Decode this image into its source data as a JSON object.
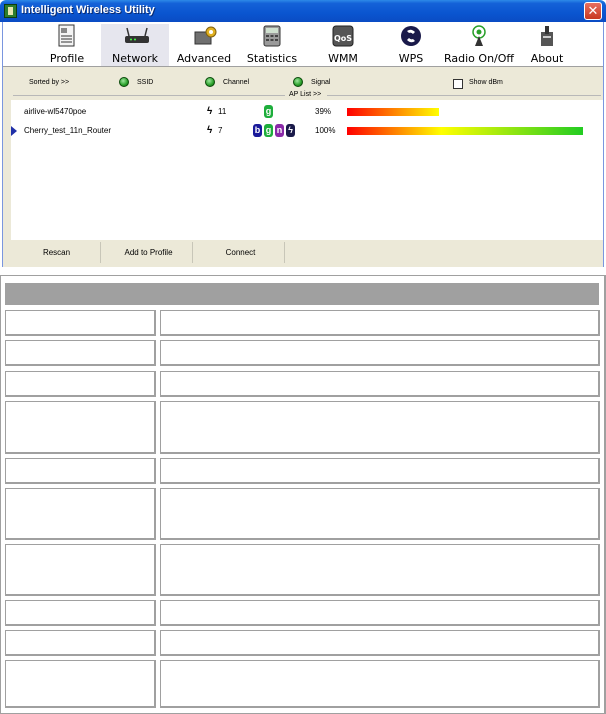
{
  "window": {
    "title": "Intelligent Wireless Utility",
    "close_glyph": "✕"
  },
  "toolbar": {
    "items": [
      {
        "label": "Profile",
        "icon": "profile-icon"
      },
      {
        "label": "Network",
        "icon": "network-icon",
        "active": true
      },
      {
        "label": "Advanced",
        "icon": "advanced-icon"
      },
      {
        "label": "Statistics",
        "icon": "statistics-icon"
      },
      {
        "label": "WMM",
        "icon": "wmm-icon"
      },
      {
        "label": "WPS",
        "icon": "wps-icon"
      },
      {
        "label": "Radio On/Off",
        "icon": "radio-icon"
      },
      {
        "label": "About",
        "icon": "about-icon"
      }
    ]
  },
  "sortbar": {
    "label": "Sorted by >>",
    "options": [
      "SSID",
      "Channel",
      "Signal"
    ],
    "show_dbm_label": "Show dBm",
    "ap_list_label": "AP List >>"
  },
  "ap_list": [
    {
      "ssid": "airlive-wl5470poe",
      "channel": "11",
      "modes": [
        "g"
      ],
      "signal": "39%",
      "signal_value": 0.39,
      "selected": false
    },
    {
      "ssid": "Cherry_test_11n_Router",
      "channel": "7",
      "modes": [
        "b",
        "g",
        "n",
        "wps"
      ],
      "signal": "100%",
      "signal_value": 1.0,
      "selected": true
    }
  ],
  "buttons": {
    "rescan": "Rescan",
    "add_to_profile": "Add to Profile",
    "connect": "Connect"
  },
  "colors": {
    "mode_b": "#1a1a9a",
    "mode_g": "#1eae3c",
    "mode_n": "#8a2aa8",
    "mode_wps": "#1a1a4a",
    "signal_low": "#ff0000",
    "signal_mid": "#ffff00",
    "signal_high": "#22cc22"
  }
}
